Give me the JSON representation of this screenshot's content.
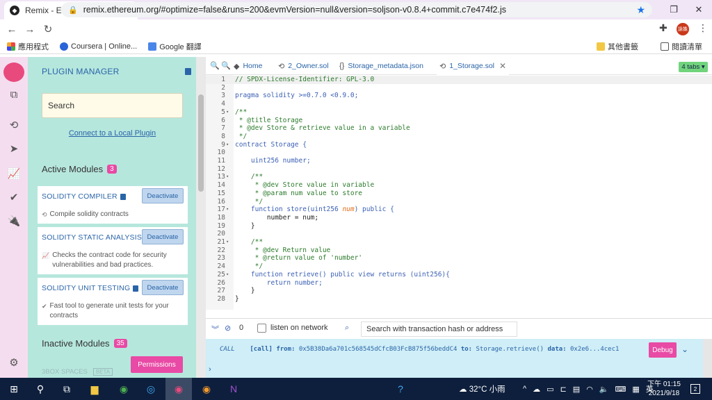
{
  "browser": {
    "tab_title": "Remix - Ethereum IDE",
    "url": "remix.ethereum.org/#optimize=false&runs=200&evmVersion=null&version=soljson-v0.8.4+commit.c7e474f2.js",
    "bookmarks": [
      "應用程式",
      "Coursera | Online...",
      "Google 翻譯"
    ],
    "bookmarks_right": [
      "其他書籤",
      "閱讀清單"
    ],
    "avatar_text": "詠姝"
  },
  "plugin_manager": {
    "title": "PLUGIN MANAGER",
    "search_placeholder": "Search",
    "local_link": "Connect to a Local Plugin",
    "active_title": "Active Modules",
    "active_count": "3",
    "inactive_title": "Inactive Modules",
    "inactive_count": "35",
    "modules": [
      {
        "name": "SOLIDITY COMPILER",
        "button": "Deactivate",
        "desc": "Compile solidity contracts"
      },
      {
        "name": "SOLIDITY STATIC ANALYSIS",
        "button": "Deactivate",
        "desc1": "Checks the contract code for security",
        "desc2": "vulnerabilities and bad practices."
      },
      {
        "name": "SOLIDITY UNIT TESTING",
        "button": "Deactivate",
        "desc1": "Fast tool to generate unit tests for your",
        "desc2": "contracts"
      }
    ],
    "permissions": "Permissions",
    "box3": "3BOX SPACES",
    "beta": "BETA"
  },
  "editor": {
    "tabs": [
      {
        "label": "Home"
      },
      {
        "label": "2_Owner.sol"
      },
      {
        "label": "Storage_metadata.json"
      },
      {
        "label": "1_Storage.sol"
      }
    ],
    "tabs_count": "4 tabs",
    "lines": [
      {
        "n": "1",
        "t": "// SPDX-License-Identifier: GPL-3.0",
        "c": "comment"
      },
      {
        "n": "2",
        "t": "",
        "c": "text"
      },
      {
        "n": "3",
        "t": "pragma solidity >=0.7.0 <0.9.0;",
        "c": "key"
      },
      {
        "n": "4",
        "t": "",
        "c": "text"
      },
      {
        "n": "5",
        "t": "/**",
        "c": "comment"
      },
      {
        "n": "6",
        "t": " * @title Storage",
        "c": "comment"
      },
      {
        "n": "7",
        "t": " * @dev Store & retrieve value in a variable",
        "c": "comment"
      },
      {
        "n": "8",
        "t": " */",
        "c": "comment"
      },
      {
        "n": "9",
        "t": "contract Storage {",
        "c": "key"
      },
      {
        "n": "10",
        "t": "",
        "c": "text"
      },
      {
        "n": "11",
        "t": "    uint256 number;",
        "c": "key"
      },
      {
        "n": "12",
        "t": "",
        "c": "text"
      },
      {
        "n": "13",
        "t": "    /**",
        "c": "comment"
      },
      {
        "n": "14",
        "t": "     * @dev Store value in variable",
        "c": "comment"
      },
      {
        "n": "15",
        "t": "     * @param num value to store",
        "c": "comment"
      },
      {
        "n": "16",
        "t": "     */",
        "c": "comment"
      },
      {
        "n": "17",
        "t": "    function store(uint256 num) public {",
        "c": "key"
      },
      {
        "n": "18",
        "t": "        number = num;",
        "c": "text"
      },
      {
        "n": "19",
        "t": "    }",
        "c": "text"
      },
      {
        "n": "20",
        "t": "",
        "c": "text"
      },
      {
        "n": "21",
        "t": "    /**",
        "c": "comment"
      },
      {
        "n": "22",
        "t": "     * @dev Return value",
        "c": "comment"
      },
      {
        "n": "23",
        "t": "     * @return value of 'number'",
        "c": "comment"
      },
      {
        "n": "24",
        "t": "     */",
        "c": "comment"
      },
      {
        "n": "25",
        "t": "    function retrieve() public view returns (uint256){",
        "c": "key"
      },
      {
        "n": "26",
        "t": "        return number;",
        "c": "key"
      },
      {
        "n": "27",
        "t": "    }",
        "c": "text"
      },
      {
        "n": "28",
        "t": "}",
        "c": "text"
      }
    ]
  },
  "terminal": {
    "count": "0",
    "listen": "listen on network",
    "search_placeholder": "Search with transaction hash or address",
    "call_type": "CALL",
    "call_text": "[call]",
    "from_label": "from:",
    "from_value": "0x5B38Da6a701c568545dCfcB03FcB875f56beddC4",
    "to_label": "to:",
    "to_value": "Storage.retrieve()",
    "data_label": "data:",
    "data_value": "0x2e6...4cec1",
    "debug": "Debug"
  },
  "taskbar": {
    "weather": "32°C 小雨",
    "lang": "英",
    "time": "下午 01:15",
    "date": "2021/9/18",
    "notif_count": "2"
  },
  "colors": {
    "accent": "#e84aa5",
    "side_panel": "#b6e7dd",
    "icon_panel": "#f5ddf0",
    "link": "#2a64a8"
  }
}
